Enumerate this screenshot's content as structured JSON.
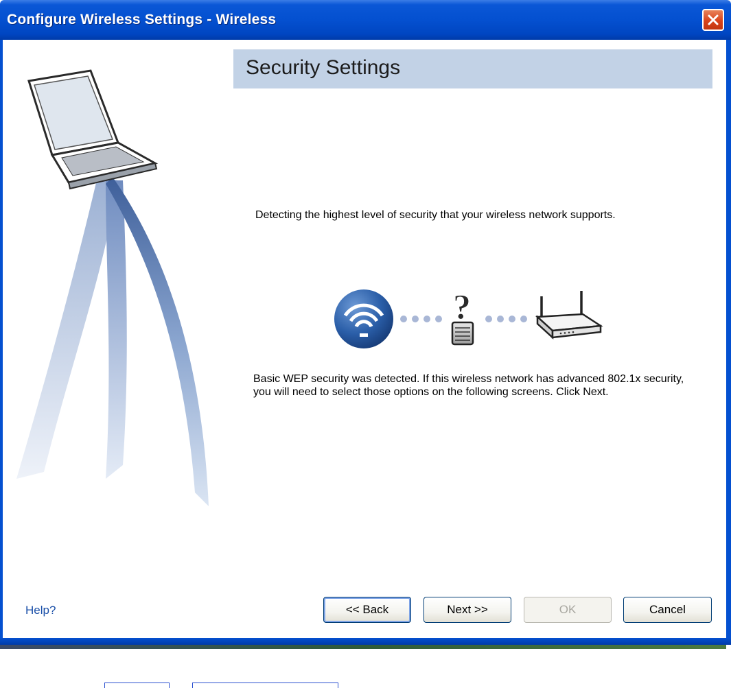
{
  "window": {
    "title": "Configure Wireless Settings - Wireless",
    "close_icon": "close-icon"
  },
  "header": {
    "title": "Security Settings"
  },
  "content": {
    "detecting_text": "Detecting the highest level of security that your wireless network supports.",
    "result_text": "Basic WEP security was detected. If this wireless network has advanced 802.1x security, you will need to select those options on the following screens. Click Next.",
    "diagram_icons": [
      "wireless-adapter-icon",
      "security-unknown-lock-icon",
      "router-icon"
    ]
  },
  "footer": {
    "help_label": "Help?",
    "back_label": "<< Back",
    "next_label": "Next >>",
    "ok_label": "OK",
    "cancel_label": "Cancel"
  },
  "colors": {
    "titlebar": "#0450d0",
    "header_band": "#c2d2e6",
    "help_link": "#1a4fa8",
    "close_button": "#d9431b"
  }
}
